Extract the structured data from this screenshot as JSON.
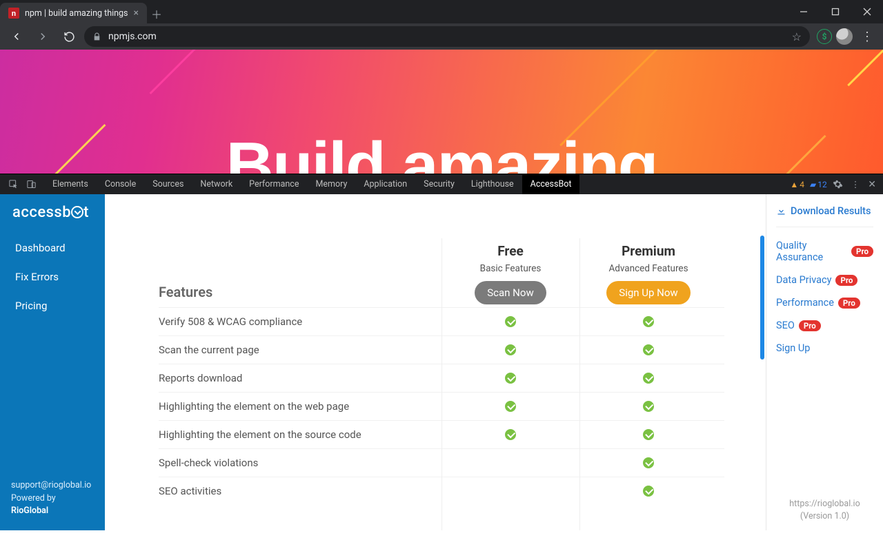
{
  "browser": {
    "tab_title": "npm | build amazing things",
    "url": "npmjs.com"
  },
  "hero": {
    "headline": "Build amazing"
  },
  "devtools": {
    "tabs": [
      "Elements",
      "Console",
      "Sources",
      "Network",
      "Performance",
      "Memory",
      "Application",
      "Security",
      "Lighthouse",
      "AccessBot"
    ],
    "active_tab": "AccessBot",
    "warnings": "4",
    "messages": "12"
  },
  "sidebar": {
    "brand_prefix": "accessb",
    "brand_suffix": "t",
    "items": [
      "Dashboard",
      "Fix Errors",
      "Pricing"
    ],
    "support_email": "support@rioglobal.io",
    "powered_prefix": "Powered by ",
    "powered_link": "RioGlobal"
  },
  "pricing": {
    "features_heading": "Features",
    "plans": [
      {
        "name": "Free",
        "subtitle": "Basic Features",
        "cta": "Scan Now"
      },
      {
        "name": "Premium",
        "subtitle": "Advanced Features",
        "cta": "Sign Up Now"
      }
    ],
    "rows": [
      {
        "label": "Verify 508 & WCAG compliance",
        "free": true,
        "premium": true
      },
      {
        "label": "Scan the current page",
        "free": true,
        "premium": true
      },
      {
        "label": "Reports download",
        "free": true,
        "premium": true
      },
      {
        "label": "Highlighting the element on the web page",
        "free": true,
        "premium": true
      },
      {
        "label": "Highlighting the element on the source code",
        "free": true,
        "premium": true
      },
      {
        "label": "Spell-check violations",
        "free": false,
        "premium": true
      },
      {
        "label": "SEO activities",
        "free": false,
        "premium": true
      }
    ]
  },
  "rightpane": {
    "download": "Download Results",
    "links": [
      {
        "label": "Quality Assurance",
        "pro": true
      },
      {
        "label": "Data Privacy",
        "pro": true
      },
      {
        "label": "Performance",
        "pro": true
      },
      {
        "label": "SEO",
        "pro": true
      },
      {
        "label": "Sign Up",
        "pro": false
      }
    ],
    "pro_badge": "Pro",
    "footer_url": "https://rioglobal.io",
    "footer_version": "(Version 1.0)"
  }
}
